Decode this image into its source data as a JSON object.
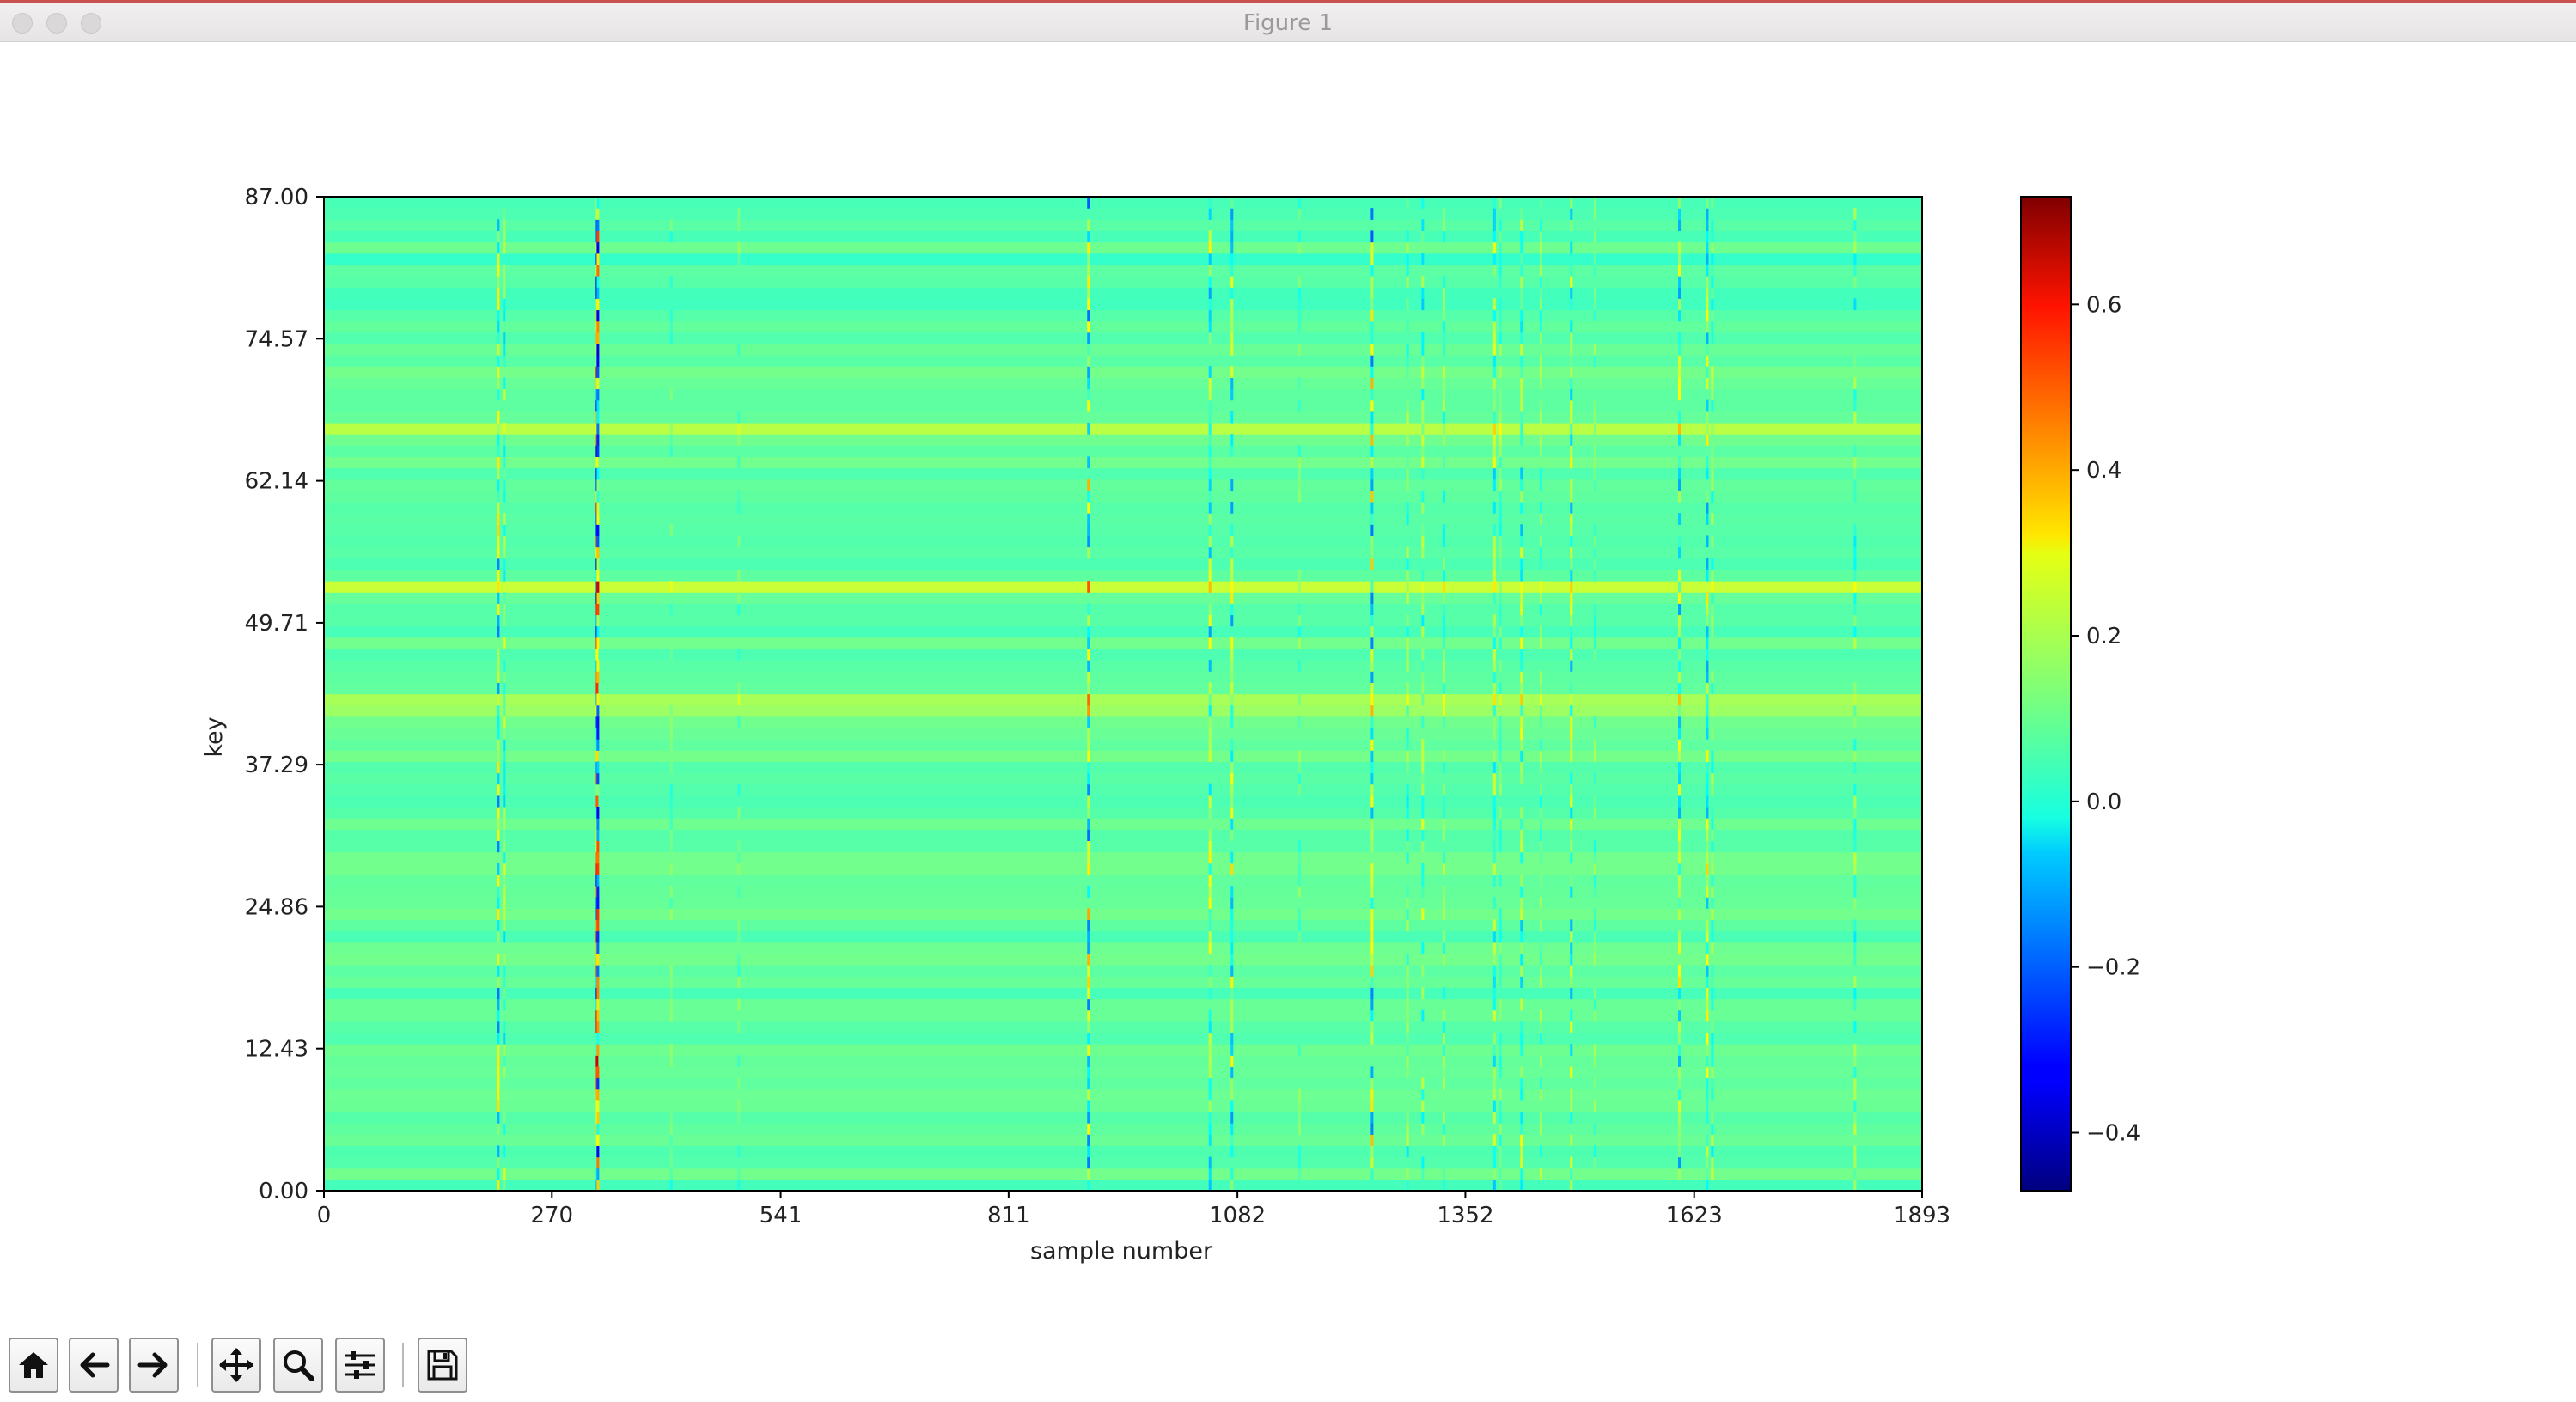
{
  "window": {
    "title": "Figure 1"
  },
  "colors": {
    "accent_strip": "#c9524f",
    "axes_frame": "#000000",
    "text": "#222222"
  },
  "toolbar": {
    "buttons": [
      {
        "name": "home-button",
        "icon": "home-icon"
      },
      {
        "name": "back-button",
        "icon": "arrow-left-icon"
      },
      {
        "name": "forward-button",
        "icon": "arrow-right-icon"
      },
      {
        "name": "pan-button",
        "icon": "move-icon"
      },
      {
        "name": "zoom-button",
        "icon": "magnifier-icon"
      },
      {
        "name": "subplots-button",
        "icon": "sliders-icon"
      },
      {
        "name": "save-button",
        "icon": "floppy-disk-icon"
      }
    ]
  },
  "chart_data": {
    "type": "heatmap",
    "colormap": "jet",
    "xlabel": "sample number",
    "ylabel": "key",
    "xlim": [
      0,
      1893
    ],
    "ylim": [
      0,
      87
    ],
    "x_ticks": [
      0,
      270,
      541,
      811,
      1082,
      1352,
      1623,
      1893
    ],
    "x_tick_labels": [
      "0",
      "270",
      "541",
      "811",
      "1082",
      "1352",
      "1623",
      "1893"
    ],
    "y_ticks": [
      0,
      12.43,
      24.86,
      37.29,
      49.71,
      62.14,
      74.57,
      87
    ],
    "y_tick_labels": [
      "0.00",
      "12.43",
      "24.86",
      "37.29",
      "49.71",
      "62.14",
      "74.57",
      "87.00"
    ],
    "colorbar": {
      "vmin": -0.47,
      "vmax": 0.73,
      "ticks": [
        -0.4,
        -0.2,
        0.0,
        0.2,
        0.4,
        0.6
      ],
      "tick_labels": [
        "−0.4",
        "−0.2",
        "0.0",
        "0.2",
        "0.4",
        "0.6"
      ]
    },
    "background_value": 0.09,
    "active_columns": [
      {
        "x": 205,
        "amp": 0.25
      },
      {
        "x": 212,
        "amp": 0.15
      },
      {
        "x": 322,
        "amp": 0.55
      },
      {
        "x": 323,
        "amp": 0.45
      },
      {
        "x": 410,
        "amp": 0.06
      },
      {
        "x": 490,
        "amp": 0.06
      },
      {
        "x": 904,
        "amp": 0.28
      },
      {
        "x": 1048,
        "amp": 0.2
      },
      {
        "x": 1074,
        "amp": 0.22
      },
      {
        "x": 1154,
        "amp": 0.06
      },
      {
        "x": 1240,
        "amp": 0.28
      },
      {
        "x": 1282,
        "amp": 0.12
      },
      {
        "x": 1300,
        "amp": 0.14
      },
      {
        "x": 1325,
        "amp": 0.12
      },
      {
        "x": 1385,
        "amp": 0.16
      },
      {
        "x": 1392,
        "amp": 0.1
      },
      {
        "x": 1417,
        "amp": 0.18
      },
      {
        "x": 1440,
        "amp": 0.1
      },
      {
        "x": 1476,
        "amp": 0.2
      },
      {
        "x": 1504,
        "amp": 0.08
      },
      {
        "x": 1604,
        "amp": 0.22
      },
      {
        "x": 1637,
        "amp": 0.22
      },
      {
        "x": 1643,
        "amp": 0.12
      },
      {
        "x": 1812,
        "amp": 0.12
      }
    ]
  }
}
